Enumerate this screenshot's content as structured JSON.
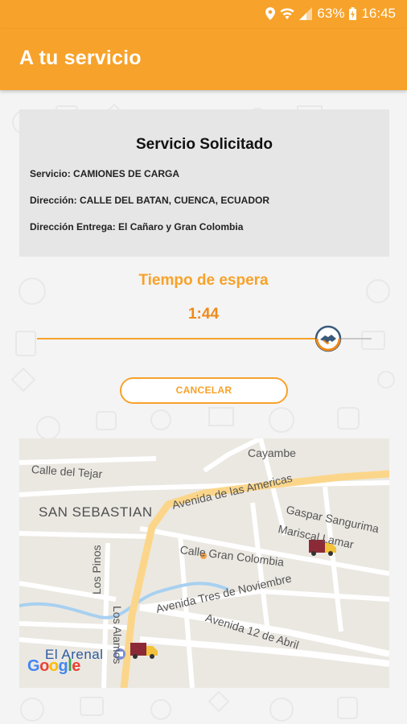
{
  "status_bar": {
    "battery_percent": "63%",
    "time": "16:45",
    "icons": [
      "location-icon",
      "wifi-icon",
      "signal-icon",
      "battery-charging-icon"
    ]
  },
  "app_bar": {
    "title": "A tu servicio"
  },
  "service_card": {
    "title": "Servicio Solicitado",
    "service_line": "Servicio: CAMIONES DE CARGA",
    "address_line": "Dirección: CALLE DEL BATAN, CUENCA, ECUADOR",
    "delivery_line": "Dirección Entrega: El Cañaro y Gran Colombia"
  },
  "wait": {
    "title": "Tiempo de espera",
    "time": "1:44",
    "progress_fraction": 0.87
  },
  "cancel_button": {
    "label": "CANCELAR"
  },
  "map": {
    "labels": {
      "cayambe": "Cayambe",
      "calle_tejar": "Calle del Tejar",
      "av_americas": "Avenida de las Americas",
      "san_sebastian": "SAN SEBASTIAN",
      "gaspar": "Gaspar Sangurima",
      "mariscal": "Mariscal Lamar",
      "gran_colombia": "Calle Gran Colombia",
      "los_pinos": "Los Pinos",
      "los_alamos": "Los Alamos",
      "tres_noviembre": "Avenida Tres de Noviembre",
      "doce_abril": "Avenida 12 de Abril",
      "el_arenal": "El Arenal"
    },
    "google_logo": "Google"
  },
  "colors": {
    "accent": "#f7a22a",
    "accent_dark": "#f08a1a",
    "truck_body": "#8b2a36"
  }
}
